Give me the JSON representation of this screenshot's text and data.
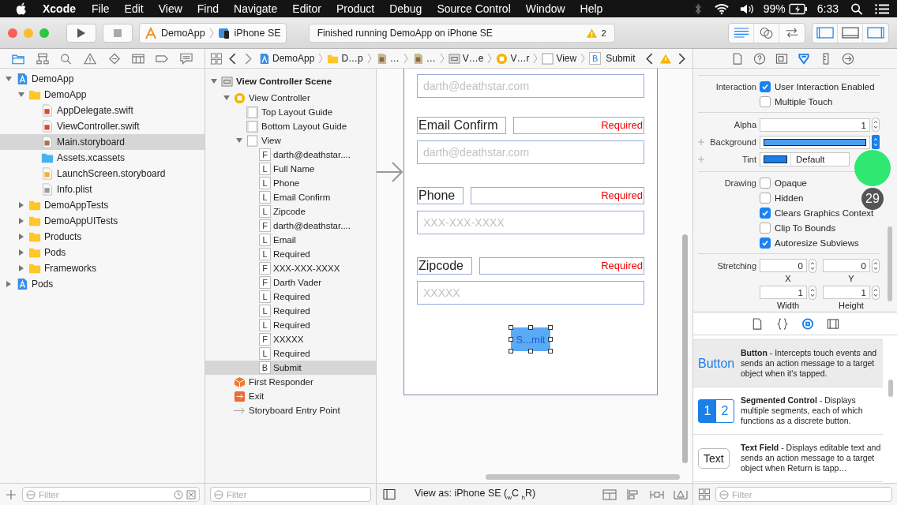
{
  "menu_bar": {
    "app": "Xcode",
    "items": [
      "File",
      "Edit",
      "View",
      "Find",
      "Navigate",
      "Editor",
      "Product",
      "Debug",
      "Source Control",
      "Window",
      "Help"
    ],
    "battery": "99%",
    "time": "6:33"
  },
  "toolbar": {
    "scheme": "DemoApp",
    "device": "iPhone SE",
    "status": "Finished running DemoApp on iPhone SE",
    "warning_count": "2",
    "editor_modes": [
      {
        "kind": "standard",
        "selected": true
      },
      {
        "kind": "assistant",
        "selected": false
      },
      {
        "kind": "version",
        "selected": false
      }
    ],
    "panels": [
      {
        "kind": "navigator",
        "selected": true
      },
      {
        "kind": "debug",
        "selected": false
      },
      {
        "kind": "utilities",
        "selected": true
      }
    ]
  },
  "navigator": {
    "tabs": [
      {
        "kind": "folder",
        "selected": true
      },
      {
        "kind": "hierarchy",
        "selected": false
      },
      {
        "kind": "search",
        "selected": false
      },
      {
        "kind": "warning",
        "selected": false
      },
      {
        "kind": "test",
        "selected": false
      },
      {
        "kind": "debug",
        "selected": false
      },
      {
        "kind": "breakpoint",
        "selected": false
      },
      {
        "kind": "report",
        "selected": false
      }
    ],
    "tree": [
      {
        "name": "DemoApp",
        "kind": "project",
        "expanded": true,
        "selected": false,
        "children": [
          {
            "name": "DemoApp",
            "kind": "folder",
            "expanded": true,
            "selected": false,
            "children": [
              {
                "name": "AppDelegate.swift",
                "kind": "swift",
                "selected": false
              },
              {
                "name": "ViewController.swift",
                "kind": "swift",
                "selected": false
              },
              {
                "name": "Main.storyboard",
                "kind": "storyboard",
                "selected": true
              },
              {
                "name": "Assets.xcassets",
                "kind": "assets",
                "selected": false
              },
              {
                "name": "LaunchScreen.storyboard",
                "kind": "launch",
                "selected": false
              },
              {
                "name": "Info.plist",
                "kind": "plist",
                "selected": false
              }
            ]
          },
          {
            "name": "DemoAppTests",
            "kind": "folder",
            "expanded": false,
            "selected": false
          },
          {
            "name": "DemoAppUITests",
            "kind": "folder",
            "expanded": false,
            "selected": false
          },
          {
            "name": "Products",
            "kind": "folder",
            "expanded": false,
            "selected": false
          },
          {
            "name": "Pods",
            "kind": "folder",
            "expanded": false,
            "selected": false
          },
          {
            "name": "Frameworks",
            "kind": "folder",
            "expanded": false,
            "selected": false
          }
        ]
      },
      {
        "name": "Pods",
        "kind": "project",
        "expanded": false,
        "selected": false
      }
    ],
    "filter": {
      "placeholder": "Filter"
    }
  },
  "jump_bar": {
    "crumbs": [
      {
        "kind": "project",
        "label": "DemoApp"
      },
      {
        "kind": "folder",
        "label": "D…p"
      },
      {
        "kind": "storyboard",
        "label": "…"
      },
      {
        "kind": "storyboard",
        "label": "…"
      },
      {
        "kind": "scene",
        "label": "V…e"
      },
      {
        "kind": "controller",
        "label": "V…r"
      },
      {
        "kind": "view",
        "label": "View"
      },
      {
        "kind": "element",
        "badge": "B",
        "label": "Submit"
      }
    ]
  },
  "outline": {
    "tree": [
      {
        "name": "View Controller Scene",
        "kind": "scene",
        "expanded": true,
        "selected": false,
        "children": [
          {
            "name": "View Controller",
            "kind": "controller",
            "expanded": true,
            "selected": false,
            "children": [
              {
                "name": "Top Layout Guide",
                "kind": "guide",
                "selected": false
              },
              {
                "name": "Bottom Layout Guide",
                "kind": "guide",
                "selected": false
              },
              {
                "name": "View",
                "kind": "view",
                "expanded": true,
                "selected": false,
                "children": [
                  {
                    "name": "darth@deathstar....",
                    "kind": "element",
                    "badge": "F",
                    "selected": false
                  },
                  {
                    "name": "Full Name",
                    "kind": "element",
                    "badge": "L",
                    "selected": false
                  },
                  {
                    "name": "Phone",
                    "kind": "element",
                    "badge": "L",
                    "selected": false
                  },
                  {
                    "name": "Email Confirm",
                    "kind": "element",
                    "badge": "L",
                    "selected": false
                  },
                  {
                    "name": "Zipcode",
                    "kind": "element",
                    "badge": "L",
                    "selected": false
                  },
                  {
                    "name": "darth@deathstar....",
                    "kind": "element",
                    "badge": "F",
                    "selected": false
                  },
                  {
                    "name": "Email",
                    "kind": "element",
                    "badge": "L",
                    "selected": false
                  },
                  {
                    "name": "Required",
                    "kind": "element",
                    "badge": "L",
                    "selected": false
                  },
                  {
                    "name": "XXX-XXX-XXXX",
                    "kind": "element",
                    "badge": "F",
                    "selected": false
                  },
                  {
                    "name": "Darth Vader",
                    "kind": "element",
                    "badge": "F",
                    "selected": false
                  },
                  {
                    "name": "Required",
                    "kind": "element",
                    "badge": "L",
                    "selected": false
                  },
                  {
                    "name": "Required",
                    "kind": "element",
                    "badge": "L",
                    "selected": false
                  },
                  {
                    "name": "Required",
                    "kind": "element",
                    "badge": "L",
                    "selected": false
                  },
                  {
                    "name": "XXXXX",
                    "kind": "element",
                    "badge": "F",
                    "selected": false
                  },
                  {
                    "name": "Required",
                    "kind": "element",
                    "badge": "L",
                    "selected": false
                  },
                  {
                    "name": "Submit",
                    "kind": "element",
                    "badge": "B",
                    "selected": true
                  }
                ]
              }
            ]
          },
          {
            "name": "First Responder",
            "kind": "responder",
            "selected": false
          },
          {
            "name": "Exit",
            "kind": "exit",
            "selected": false
          },
          {
            "name": "Storyboard Entry Point",
            "kind": "entry",
            "selected": false
          }
        ]
      }
    ],
    "filter": {
      "placeholder": "Filter"
    }
  },
  "canvas": {
    "form": [
      {
        "kind": "field",
        "placeholder": "darth@deathstar.com"
      },
      {
        "kind": "label",
        "label": "Email Confirm",
        "note": "Required"
      },
      {
        "kind": "field",
        "placeholder": "darth@deathstar.com"
      },
      {
        "kind": "label",
        "label": "Phone",
        "note": "Required"
      },
      {
        "kind": "field",
        "placeholder": "XXX-XXX-XXXX"
      },
      {
        "kind": "label",
        "label": "Zipcode",
        "note": "Required"
      },
      {
        "kind": "field",
        "placeholder": "XXXXX"
      }
    ],
    "button": {
      "title": "S...mit",
      "selected": true
    },
    "view_as": "View as: iPhone SE ($_{w}$C $_{h}$R)"
  },
  "inspector": {
    "tabs": [
      {
        "kind": "file",
        "selected": false
      },
      {
        "kind": "help",
        "selected": false
      },
      {
        "kind": "identity",
        "selected": false
      },
      {
        "kind": "attributes",
        "selected": true
      },
      {
        "kind": "size",
        "selected": false
      },
      {
        "kind": "connections",
        "selected": false
      }
    ],
    "interaction": {
      "label": "Interaction",
      "options": [
        {
          "label": "User Interaction Enabled",
          "checked": true
        },
        {
          "label": "Multiple Touch",
          "checked": false
        }
      ]
    },
    "alpha": {
      "label": "Alpha",
      "value": "1"
    },
    "background": {
      "label": "Background",
      "color": "#4a9ff0"
    },
    "tint": {
      "label": "Tint",
      "color": "#1a7fe8",
      "value": "Default"
    },
    "drawing": {
      "label": "Drawing",
      "options": [
        {
          "label": "Opaque",
          "checked": false
        },
        {
          "label": "Hidden",
          "checked": false
        },
        {
          "label": "Clears Graphics Context",
          "checked": true
        },
        {
          "label": "Clip To Bounds",
          "checked": false
        },
        {
          "label": "Autoresize Subviews",
          "checked": true
        }
      ]
    },
    "stretching": {
      "label": "Stretching",
      "fields": [
        {
          "caption": "X",
          "value": "0"
        },
        {
          "caption": "Y",
          "value": "0"
        },
        {
          "caption": "Width",
          "value": "1"
        },
        {
          "caption": "Height",
          "value": "1"
        }
      ]
    }
  },
  "library": {
    "tabs": [
      {
        "kind": "file",
        "selected": false
      },
      {
        "kind": "code",
        "selected": false
      },
      {
        "kind": "object",
        "selected": true
      },
      {
        "kind": "media",
        "selected": false
      }
    ],
    "items": [
      {
        "kind": "button",
        "preview": "Button",
        "text": "**Button** - Intercepts touch events and sends an action message to a target object when it's tapped.",
        "selected": true
      },
      {
        "kind": "segmented",
        "segments": [
          "1",
          "2"
        ],
        "text": "**Segmented Control** - Displays multiple segments, each of which functions as a discrete button.",
        "selected": false
      },
      {
        "kind": "text_field",
        "preview": "Text",
        "text": "**Text Field** - Displays editable text and sends an action message to a target object when Return is tapp…",
        "selected": false
      }
    ],
    "filter": {
      "placeholder": "Filter"
    }
  },
  "tap_indicator": {
    "step": "29"
  }
}
